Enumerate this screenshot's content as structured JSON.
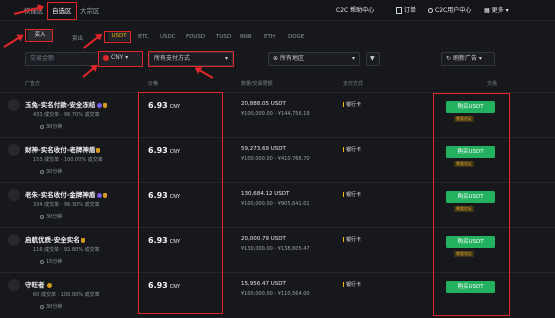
{
  "header": {
    "tabs": [
      {
        "label": "快捷区"
      },
      {
        "label": "自选区"
      },
      {
        "label": "大宗区"
      }
    ],
    "menu": [
      {
        "label": "C2C 帮助中心"
      },
      {
        "label": "订单"
      },
      {
        "label": "C2C用户中心"
      },
      {
        "label": "更多"
      }
    ]
  },
  "subnav": {
    "buy": "买入",
    "sell": "卖出",
    "assets": [
      "USDT",
      "BTC",
      "USDC",
      "FDUSD",
      "TUSD",
      "BNB",
      "ETH",
      "DOGE"
    ]
  },
  "filters": {
    "amount_placeholder": "交易金额",
    "currency": "CNY",
    "payment": "所有支付方式",
    "region": "所有地区",
    "refresh": "刷新广告"
  },
  "columns": [
    "广告方",
    "价格",
    "数量/交易限额",
    "支付方式",
    "交易"
  ],
  "rows": [
    {
      "name": "玉兔-实名付款-安全冻结",
      "orders": "433 成交单",
      "rate": "96.70% 成交率",
      "time": "30分钟",
      "price": "6.93",
      "currency": "CNY",
      "amount": "20,888.05 USDT",
      "limit": "¥100,000.00 - ¥144,756.19",
      "payment": "银行卡",
      "button": "购买USDT",
      "badge": "需要验证"
    },
    {
      "name": "财神-实名收付-老牌神盾",
      "orders": "153 成交单",
      "rate": "100.00% 成交率",
      "time": "30分钟",
      "price": "6.93",
      "currency": "CNY",
      "amount": "59,273.69 USDT",
      "limit": "¥100,000.00 - ¥410,766.70",
      "payment": "银行卡",
      "button": "购买USDT",
      "badge": "需要验证"
    },
    {
      "name": "老朱-实名收付-金牌神盾",
      "orders": "334 成交单",
      "rate": "96.30% 成交率",
      "time": "30分钟",
      "price": "6.93",
      "currency": "CNY",
      "amount": "130,684.12 USDT",
      "limit": "¥100,000.00 - ¥905,641.01",
      "payment": "银行卡",
      "button": "购买USDT",
      "badge": "需要验证"
    },
    {
      "name": "启航优质-安全实名",
      "orders": "116 成交单",
      "rate": "92.80% 成交率",
      "time": "15分钟",
      "price": "6.93",
      "currency": "CNY",
      "amount": "20,000.79 USDT",
      "limit": "¥130,000.00 - ¥138,605.47",
      "payment": "银行卡",
      "button": "购买USDT",
      "badge": "需要验证"
    },
    {
      "name": "守旺者",
      "orders": "60 成交单",
      "rate": "100.00% 成交率",
      "time": "30分钟",
      "price": "6.93",
      "currency": "CNY",
      "amount": "15,956.47 USDT",
      "limit": "¥100,000.00 - ¥110,564.00",
      "payment": "银行卡",
      "button": "购买USDT",
      "badge": ""
    }
  ],
  "colors": {
    "accent": "#f0b90b",
    "buy_button": "#23b05f",
    "annotation": "#e0262a"
  }
}
